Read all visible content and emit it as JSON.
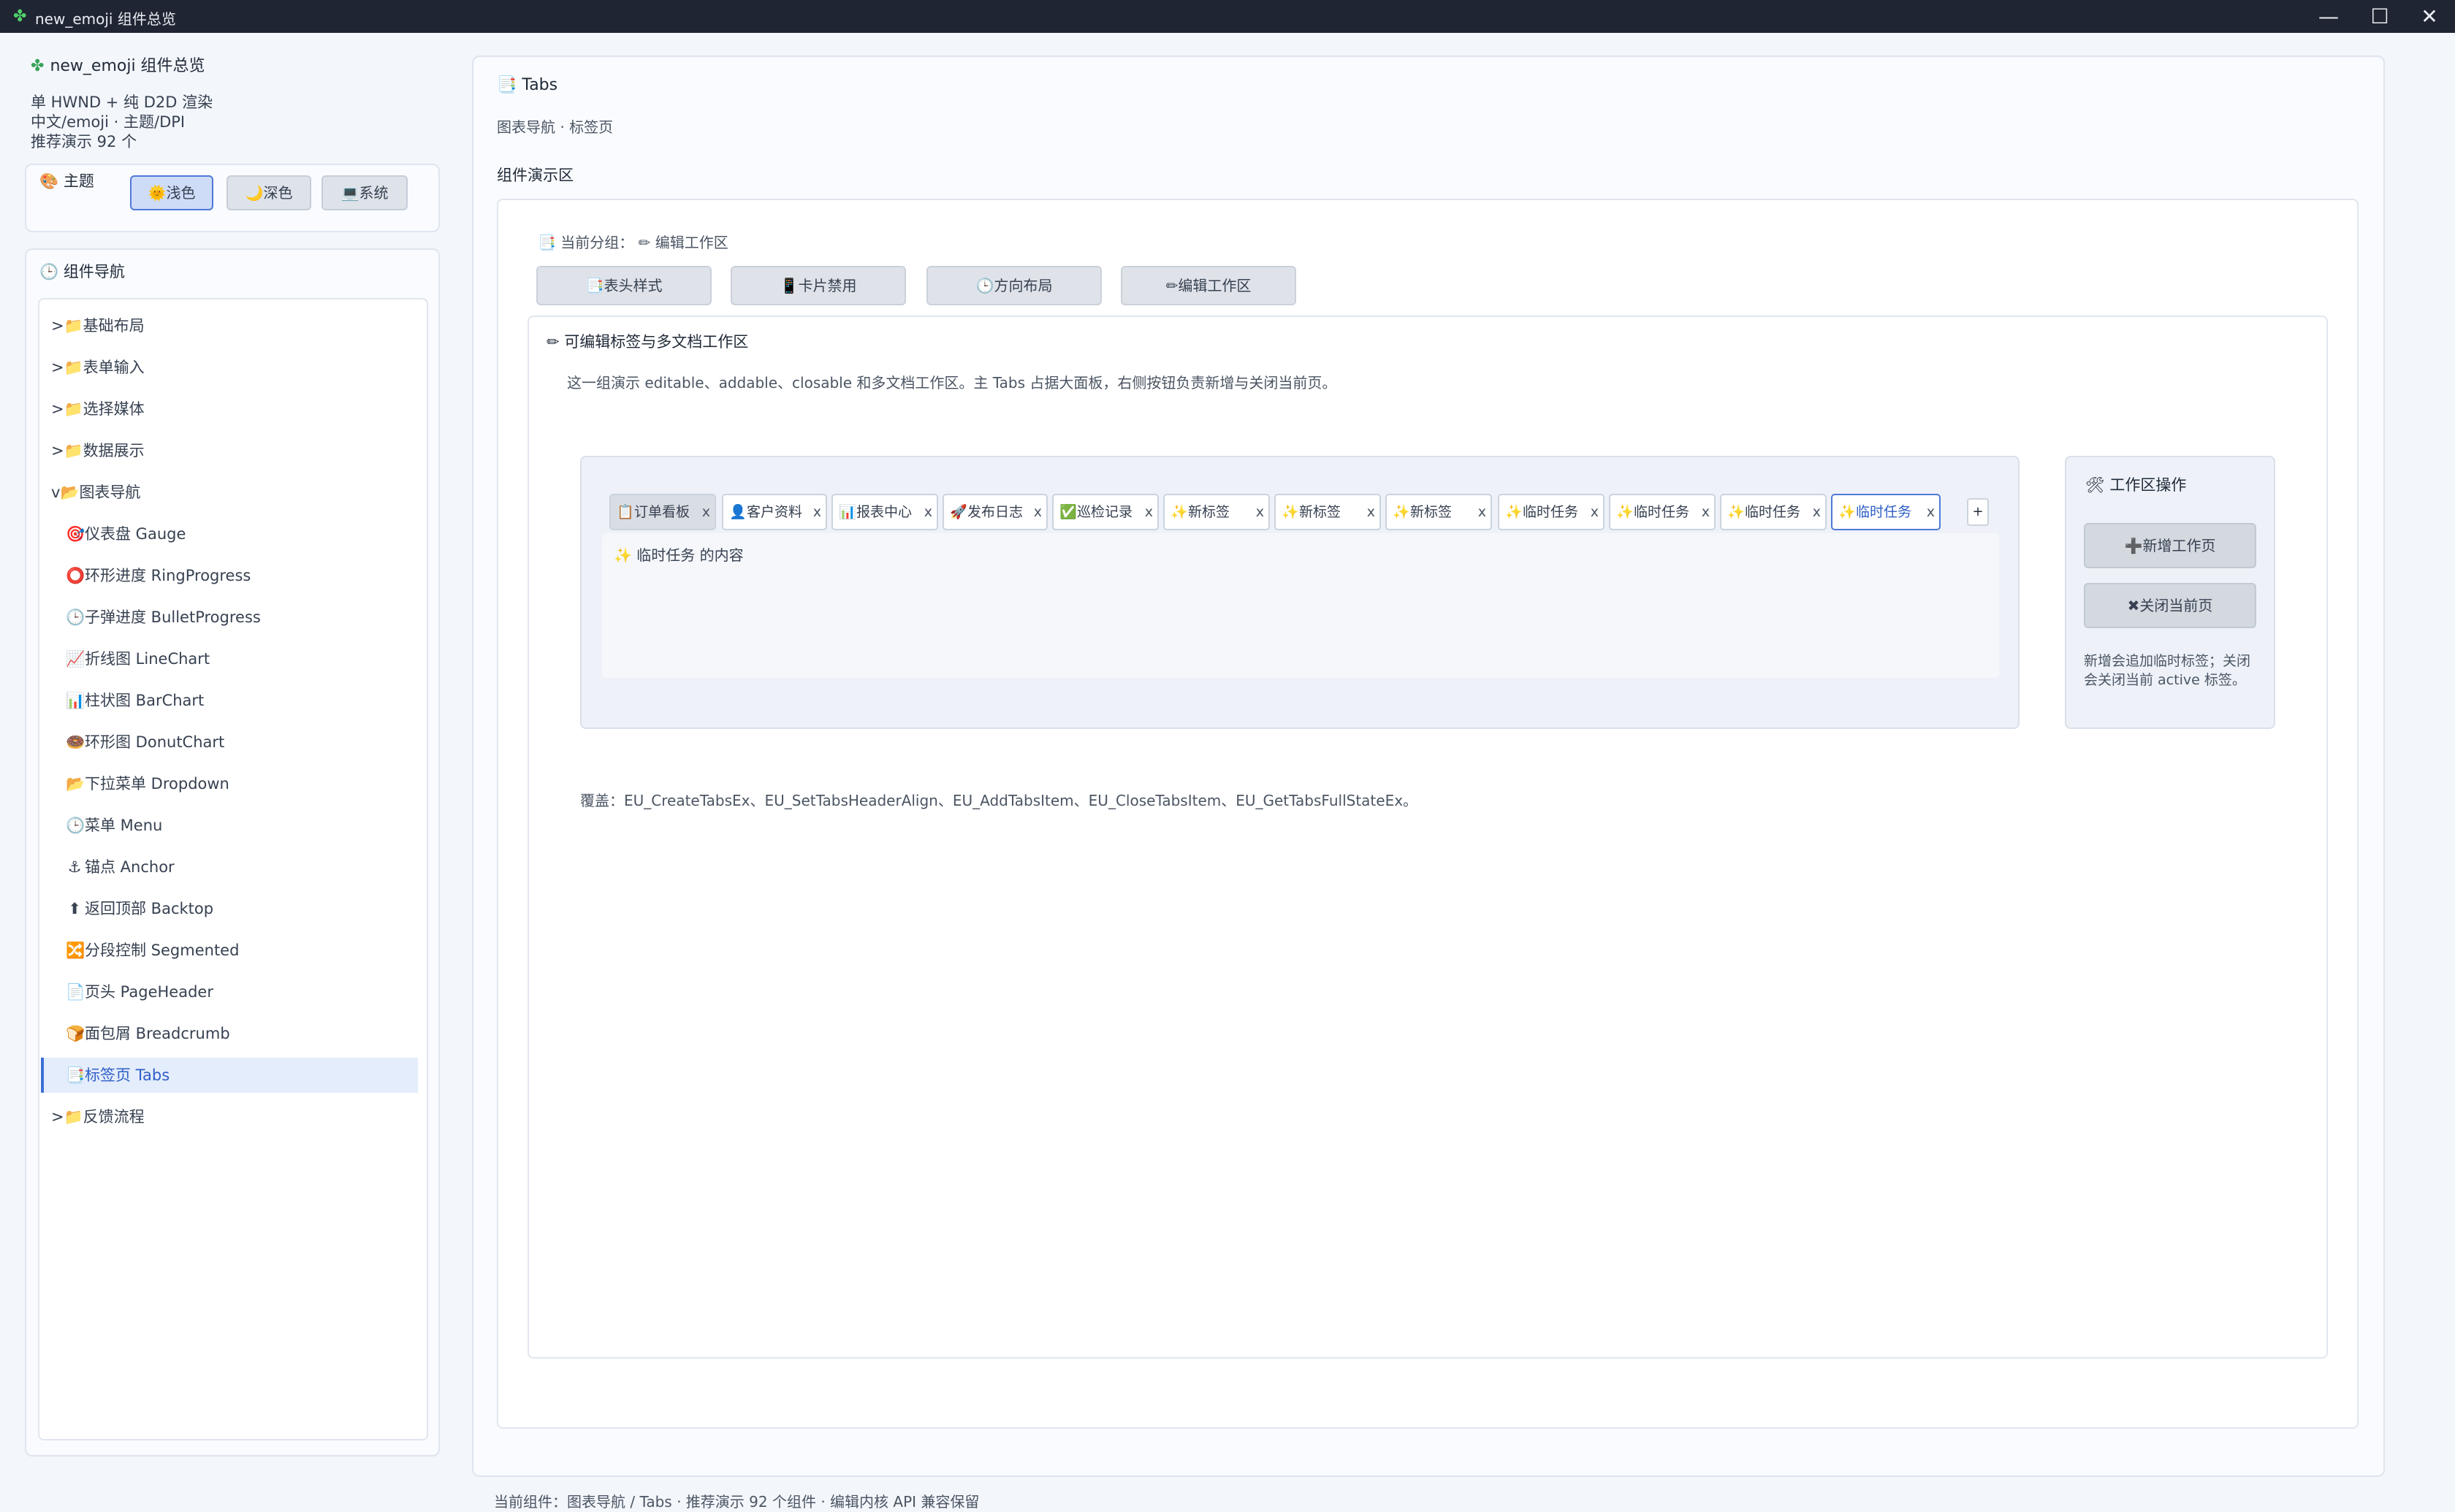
{
  "window": {
    "title": "new_emoji 组件总览",
    "icon": "clover-icon",
    "controls": {
      "minimize": "—",
      "maximize": "☐",
      "close": "✕"
    }
  },
  "sidebar": {
    "app_title": "new_emoji 组件总览",
    "info_lines": [
      "单 HWND + 纯 D2D 渲染",
      "中文/emoji · 主题/DPI",
      "推荐演示 92 个"
    ],
    "theme": {
      "label": "主题",
      "buttons": [
        {
          "icon": "🌞",
          "label": "浅色",
          "active": true
        },
        {
          "icon": "🌙",
          "label": "深色",
          "active": false
        },
        {
          "icon": "💻",
          "label": "系统",
          "active": false
        }
      ]
    },
    "nav": {
      "title": "组件导航",
      "items": [
        {
          "prefix": ">",
          "icon": "📁",
          "label": "基础布局",
          "sub": false
        },
        {
          "prefix": ">",
          "icon": "📁",
          "label": "表单输入",
          "sub": false
        },
        {
          "prefix": ">",
          "icon": "📁",
          "label": "选择媒体",
          "sub": false
        },
        {
          "prefix": ">",
          "icon": "📁",
          "label": "数据展示",
          "sub": false
        },
        {
          "prefix": "v",
          "icon": "📂",
          "label": "图表导航",
          "sub": false
        },
        {
          "prefix": "",
          "icon": "🎯",
          "label": "仪表盘 Gauge",
          "sub": true
        },
        {
          "prefix": "",
          "icon": "⭕",
          "label": "环形进度 RingProgress",
          "sub": true
        },
        {
          "prefix": "",
          "icon": "🕒",
          "label": "子弹进度 BulletProgress",
          "sub": true
        },
        {
          "prefix": "",
          "icon": "📈",
          "label": "折线图 LineChart",
          "sub": true
        },
        {
          "prefix": "",
          "icon": "📊",
          "label": "柱状图 BarChart",
          "sub": true
        },
        {
          "prefix": "",
          "icon": "🍩",
          "label": "环形图 DonutChart",
          "sub": true
        },
        {
          "prefix": "",
          "icon": "📂",
          "label": "下拉菜单 Dropdown",
          "sub": true
        },
        {
          "prefix": "",
          "icon": "🕒",
          "label": "菜单 Menu",
          "sub": true
        },
        {
          "prefix": "",
          "icon": "⚓",
          "label": "锚点 Anchor",
          "sub": true
        },
        {
          "prefix": "",
          "icon": "⬆",
          "label": "返回顶部 Backtop",
          "sub": true
        },
        {
          "prefix": "",
          "icon": "🔀",
          "label": "分段控制 Segmented",
          "sub": true
        },
        {
          "prefix": "",
          "icon": "📄",
          "label": "页头 PageHeader",
          "sub": true
        },
        {
          "prefix": "",
          "icon": "🍞",
          "label": "面包屑 Breadcrumb",
          "sub": true
        },
        {
          "prefix": "",
          "icon": "📑",
          "label": "标签页 Tabs",
          "sub": true,
          "active": true
        },
        {
          "prefix": ">",
          "icon": "📁",
          "label": "反馈流程",
          "sub": false
        }
      ]
    }
  },
  "main": {
    "title": "Tabs",
    "subtitle": "图表导航 · 标签页",
    "demo_label": "组件演示区",
    "current_group_prefix": "当前分组：",
    "current_group": "编辑工作区",
    "group_buttons": [
      {
        "icon": "📑",
        "label": "表头样式"
      },
      {
        "icon": "📱",
        "label": "卡片禁用"
      },
      {
        "icon": "🕒",
        "label": "方向布局"
      },
      {
        "icon": "✏",
        "label": "编辑工作区"
      }
    ],
    "section_title": "可编辑标签与多文档工作区",
    "section_desc": "这一组演示 editable、addable、closable 和多文档工作区。主 Tabs 占据大面板，右侧按钮负责新增与关闭当前页。",
    "tabs": [
      {
        "icon": "📋",
        "label": "订单看板",
        "close": "x"
      },
      {
        "icon": "👤",
        "label": "客户资料",
        "close": "x"
      },
      {
        "icon": "📊",
        "label": "报表中心",
        "close": "x"
      },
      {
        "icon": "🚀",
        "label": "发布日志",
        "close": "x"
      },
      {
        "icon": "✅",
        "label": "巡检记录",
        "close": "x"
      },
      {
        "icon": "✨",
        "label": "新标签",
        "close": "x"
      },
      {
        "icon": "✨",
        "label": "新标签",
        "close": "x"
      },
      {
        "icon": "✨",
        "label": "新标签",
        "close": "x"
      },
      {
        "icon": "✨",
        "label": "临时任务",
        "close": "x"
      },
      {
        "icon": "✨",
        "label": "临时任务",
        "close": "x"
      },
      {
        "icon": "✨",
        "label": "临时任务",
        "close": "x"
      },
      {
        "icon": "✨",
        "label": "临时任务",
        "close": "x",
        "active": true
      }
    ],
    "add_tab": "+",
    "tab_content": "临时任务 的内容",
    "tab_content_icon": "✨",
    "ops": {
      "title": "工作区操作",
      "title_icon": "🛠",
      "add_button": "新增工作页",
      "add_icon": "➕",
      "close_button": "关闭当前页",
      "close_icon": "✖",
      "desc": "新增会追加临时标签；关闭会关闭当前 active 标签。"
    },
    "coverage": "覆盖：EU_CreateTabsEx、EU_SetTabsHeaderAlign、EU_AddTabsItem、EU_CloseTabsItem、EU_GetTabsFullStateEx。"
  },
  "status_bar": "当前组件：图表导航 / Tabs · 推荐演示 92 个组件 · 编辑内核 API 兼容保留",
  "colors": {
    "accent": "#3b6fd8",
    "titlebar": "#1f2532",
    "background": "#f3f6fb"
  }
}
